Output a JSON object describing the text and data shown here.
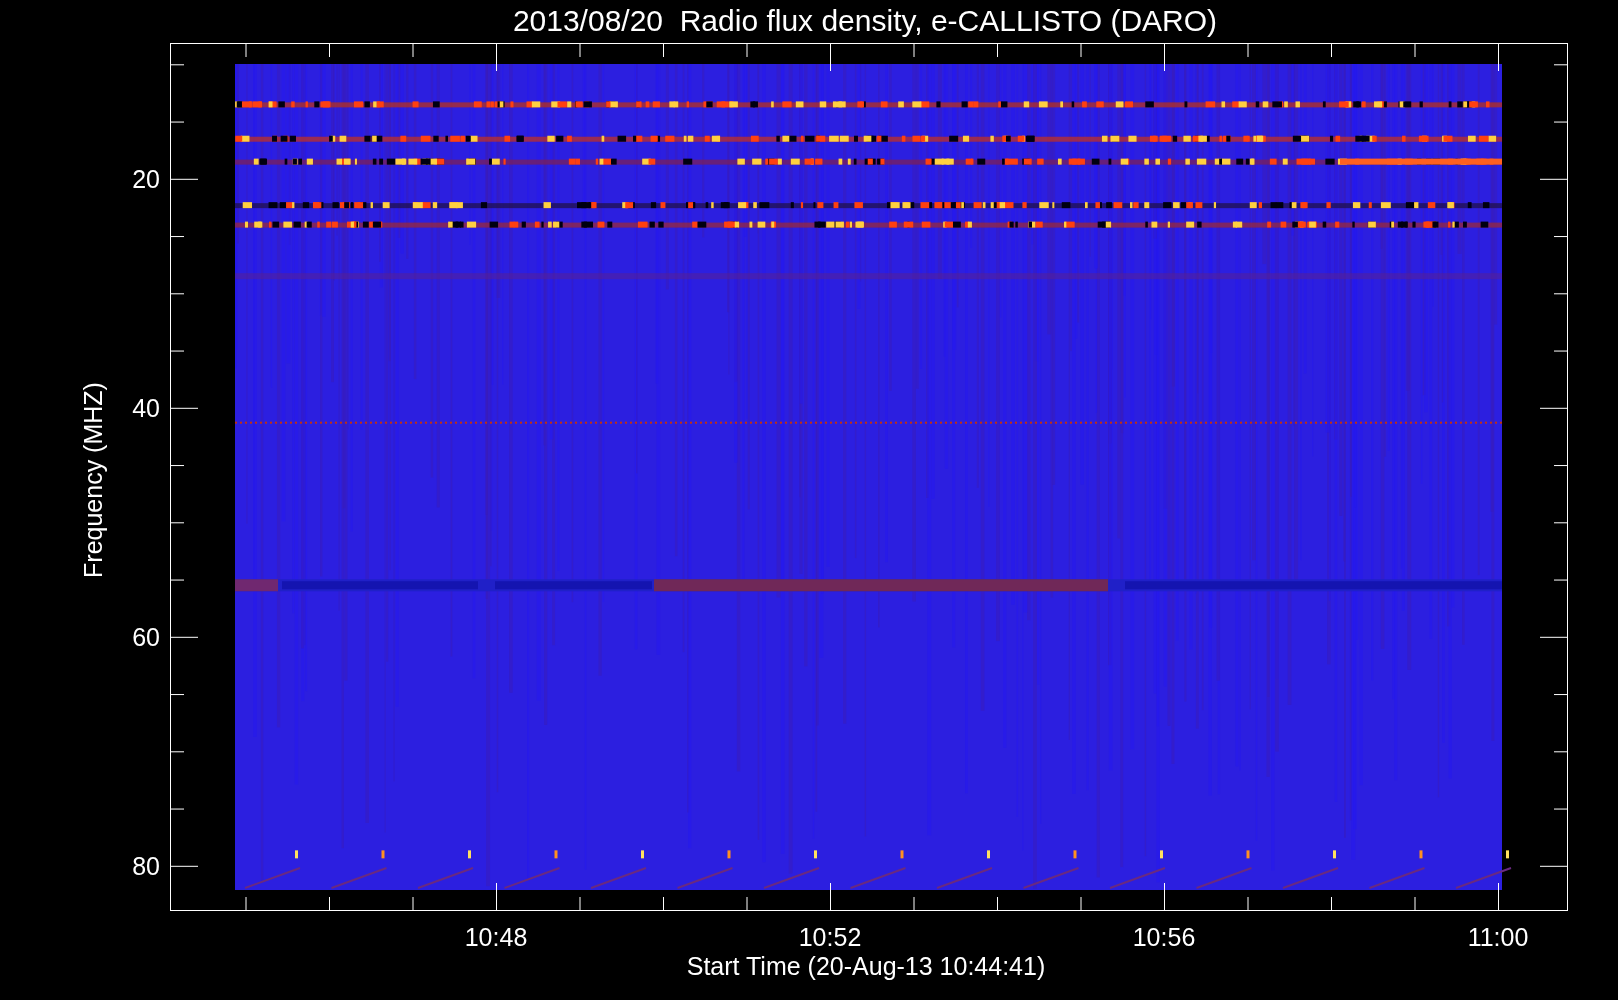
{
  "title": "2013/08/20  Radio flux density, e-CALLISTO (DARO)",
  "y_axis": {
    "label": "Frequency (MHZ)",
    "ticks": [
      "20",
      "40",
      "60",
      "80"
    ]
  },
  "x_axis": {
    "label": "Start Time (20-Aug-13 10:44:41)",
    "ticks": [
      "10:48",
      "10:52",
      "10:56",
      "11:00"
    ]
  }
}
